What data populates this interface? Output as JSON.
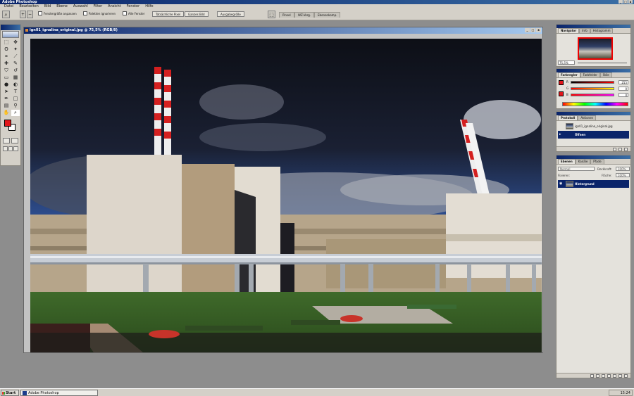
{
  "app": {
    "title": "Adobe Photoshop",
    "window_controls": [
      "_",
      "□",
      "x"
    ]
  },
  "menu": [
    "Datei",
    "Bearbeiten",
    "Bild",
    "Ebene",
    "Auswahl",
    "Filter",
    "Ansicht",
    "Fenster",
    "Hilfe"
  ],
  "options_bar": {
    "fit_window": "Fenstergröße anpassen",
    "ignore_palettes": "Paletten ignorieren",
    "all_windows": "Alle Fenster",
    "actual_pixels": "Tatsächliche Pixel",
    "fit_screen": "Ganzes Bild",
    "print_size": "Ausgabegröße",
    "workspace_tabs": [
      "Pinsel",
      "WZ-Vorg.",
      "Ebenenkomp."
    ]
  },
  "document": {
    "title": "ign01_ignalina_original.jpg @ 75,5% (RGB/8)",
    "controls": [
      "_",
      "□",
      "x"
    ]
  },
  "palettes": {
    "navigator": {
      "tabs": [
        "Navigator",
        "Info",
        "Histogramm"
      ],
      "zoom": "75,5%"
    },
    "color": {
      "tabs": [
        "Farbregler",
        "Farbfelder",
        "Stile"
      ],
      "channels": [
        {
          "label": "R",
          "value": "255"
        },
        {
          "label": "G",
          "value": "0"
        },
        {
          "label": "B",
          "value": "0"
        }
      ]
    },
    "history": {
      "tabs": [
        "Protokoll",
        "Aktionen"
      ],
      "snapshot": "ign01_ignalina_original.jpg",
      "state": "Öffnen"
    },
    "layers": {
      "tabs": [
        "Ebenen",
        "Kanäle",
        "Pfade"
      ],
      "blend_mode": "Normal",
      "opacity_label": "Deckkraft:",
      "opacity": "100%",
      "fill_label": "Fläche:",
      "fill": "100%",
      "fixieren_label": "Fixieren:",
      "layer_name": "Hintergrund"
    }
  },
  "taskbar": {
    "start": "Start",
    "task": "Adobe Photoshop",
    "clock": "15:24"
  },
  "colors": {
    "foreground": "#e2171b",
    "background": "#ffffff",
    "title_bar": "#0a246a"
  }
}
